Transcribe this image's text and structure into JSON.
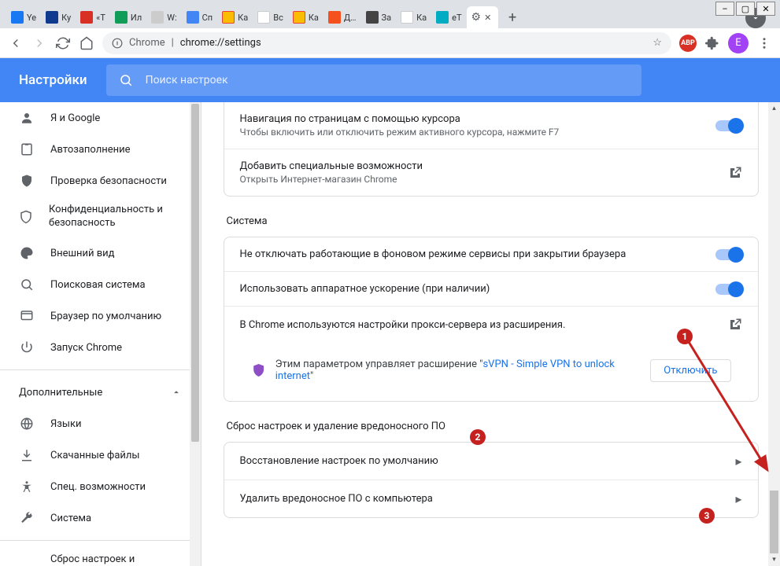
{
  "window": {
    "min": "–",
    "max": "▢",
    "close": "✕"
  },
  "tabs": [
    {
      "label": "Ye",
      "color": "#1877f2"
    },
    {
      "label": "Ку",
      "color": "#103a8e"
    },
    {
      "label": "«Т",
      "color": "#d93025"
    },
    {
      "label": "Ил",
      "color": "#0f9d58"
    },
    {
      "label": "W:",
      "color": "#ccc"
    },
    {
      "label": "Сп",
      "color": "#4285f4"
    },
    {
      "label": "Ка",
      "color": "#fbbc04"
    },
    {
      "label": "Вс",
      "color": "#fff"
    },
    {
      "label": "Ка",
      "color": "#fbbc04"
    },
    {
      "label": "Д…",
      "color": "#f4511e"
    },
    {
      "label": "За",
      "color": "#444"
    },
    {
      "label": "Ка",
      "color": "#fff"
    },
    {
      "label": "eT",
      "color": "#00acc1"
    }
  ],
  "active_tab": {
    "icon": "⚙",
    "close": "✕"
  },
  "new_tab": "+",
  "toolbar": {
    "chrome_label": "Chrome",
    "url": "chrome://settings",
    "profile_initial": "E",
    "abp": "ABP"
  },
  "header": {
    "title": "Настройки",
    "search_placeholder": "Поиск настроек"
  },
  "sidebar": {
    "items": [
      {
        "icon": "person",
        "label": "Я и Google"
      },
      {
        "icon": "autofill",
        "label": "Автозаполнение"
      },
      {
        "icon": "shield-check",
        "label": "Проверка безопасности"
      },
      {
        "icon": "shield",
        "label": "Конфиденциальность и безопасность"
      },
      {
        "icon": "palette",
        "label": "Внешний вид"
      },
      {
        "icon": "search",
        "label": "Поисковая система"
      },
      {
        "icon": "browser",
        "label": "Браузер по умолчанию"
      },
      {
        "icon": "power",
        "label": "Запуск Chrome"
      }
    ],
    "advanced": "Дополнительные",
    "adv_items": [
      {
        "icon": "globe",
        "label": "Языки"
      },
      {
        "icon": "download",
        "label": "Скачанные файлы"
      },
      {
        "icon": "accessibility",
        "label": "Спец. возможности"
      },
      {
        "icon": "wrench",
        "label": "Система"
      },
      {
        "icon": "reset",
        "label": "Сброс настроек и"
      }
    ]
  },
  "sections": {
    "a11y": {
      "row1_title": "Навигация по страницам с помощью курсора",
      "row1_sub": "Чтобы включить или отключить режим активного курсора, нажмите F7",
      "row2_title": "Добавить специальные возможности",
      "row2_sub": "Открыть Интернет-магазин Chrome"
    },
    "system": {
      "title": "Система",
      "row1": "Не отключать работающие в фоновом режиме сервисы при закрытии браузера",
      "row2": "Использовать аппаратное ускорение (при наличии)",
      "row3": "В Chrome используются настройки прокси-сервера из расширения.",
      "ext_prefix": "Этим параметром управляет расширение \"",
      "ext_name": "sVPN - Simple VPN to unlock internet",
      "ext_suffix": "\"",
      "disable": "Отключить"
    },
    "reset": {
      "title": "Сброс настроек и удаление вредоносного ПО",
      "row1": "Восстановление настроек по умолчанию",
      "row2": "Удалить вредоносное ПО с компьютера"
    }
  },
  "annotations": {
    "a1": "1",
    "a2": "2",
    "a3": "3"
  }
}
